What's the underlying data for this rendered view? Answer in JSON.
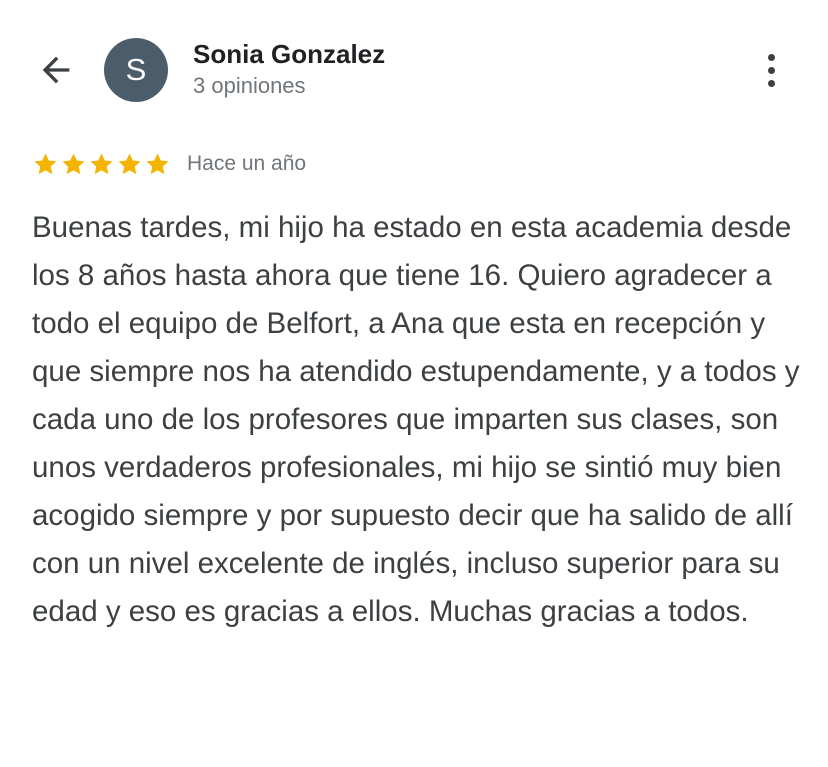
{
  "header": {
    "back_icon": "arrow-left-icon",
    "avatar_initial": "S",
    "avatar_color": "#4b5d6b",
    "reviewer_name": "Sonia Gonzalez",
    "review_count": "3 opiniones",
    "more_icon": "more-vertical-icon"
  },
  "review": {
    "rating": 5,
    "rating_max": 5,
    "star_color": "#f4b400",
    "date": "Hace un año",
    "text": "Buenas tardes, mi hijo ha estado en esta academia desde los 8 años hasta ahora que tiene 16. Quiero agradecer a todo el equipo de Belfort, a Ana que esta en recepción y que siempre nos ha atendido estupendamente, y a todos y cada uno de los profesores que imparten sus clases, son unos verdaderos profesionales, mi hijo se sintió muy bien acogido siempre y por supuesto decir que ha salido de allí con un nivel excelente de inglés, incluso superior para su edad y eso es gracias a ellos. Muchas gracias a todos."
  }
}
